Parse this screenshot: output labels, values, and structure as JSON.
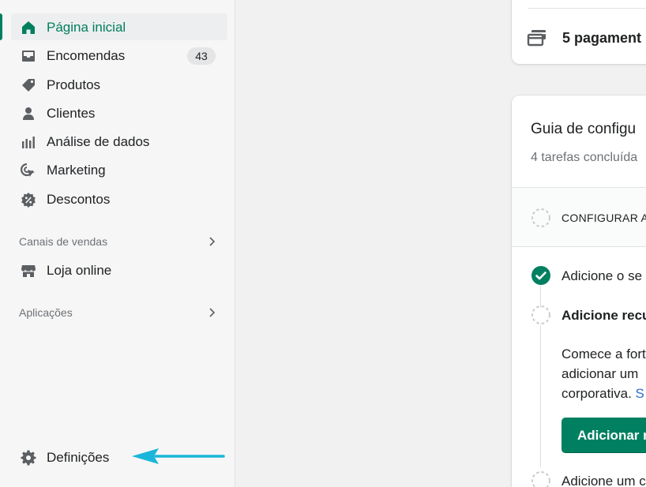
{
  "sidebar": {
    "items": [
      {
        "label": "Página inicial",
        "icon": "home-icon",
        "active": true
      },
      {
        "label": "Encomendas",
        "icon": "orders-icon",
        "badge": "43"
      },
      {
        "label": "Produtos",
        "icon": "tag-icon"
      },
      {
        "label": "Clientes",
        "icon": "person-icon"
      },
      {
        "label": "Análise de dados",
        "icon": "bar-chart-icon"
      },
      {
        "label": "Marketing",
        "icon": "marketing-icon"
      },
      {
        "label": "Descontos",
        "icon": "discount-icon"
      }
    ],
    "sales_channels": {
      "title": "Canais de vendas",
      "items": [
        {
          "label": "Loja online",
          "icon": "store-icon"
        }
      ]
    },
    "apps": {
      "title": "Aplicações"
    },
    "settings": {
      "label": "Definições",
      "icon": "gear-icon"
    },
    "annotation": {
      "icon": "arrow-left-icon",
      "color": "#1ab6d9"
    }
  },
  "main": {
    "payments_card": {
      "text": "5 pagament",
      "icon": "payments-icon"
    },
    "setup_guide": {
      "title": "Guia de configu",
      "subtitle": "4 tarefas concluída",
      "section_label": "CONFIGURAR A",
      "tasks": [
        {
          "text": "Adicione o se",
          "done": true
        },
        {
          "text": "Adicione recu",
          "done": false,
          "expanded": true,
          "description": [
            "Comece a fort",
            "adicionar um",
            "corporativa. "
          ],
          "link": "S",
          "button": "Adicionar r"
        },
        {
          "text": "Adicione um c",
          "done": false
        }
      ]
    }
  },
  "colors": {
    "accent": "#008060",
    "active_text": "#007f5f",
    "link": "#2c6ecb",
    "sidebar_bg": "#f6f6f7"
  }
}
